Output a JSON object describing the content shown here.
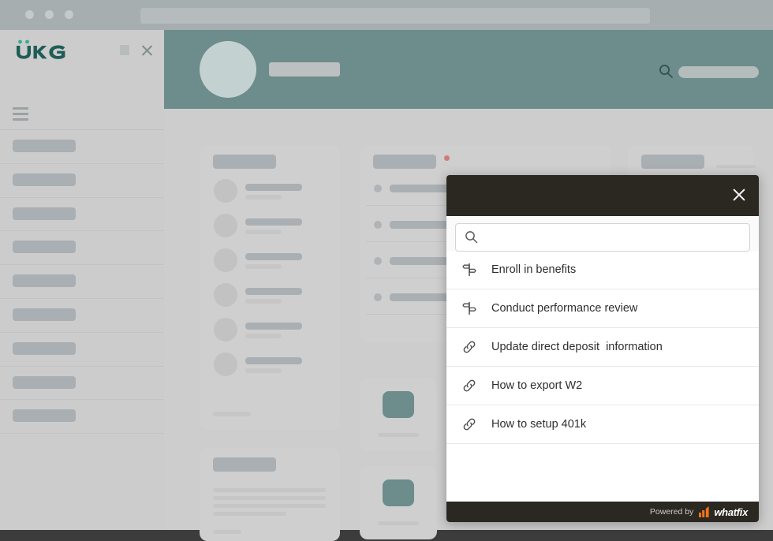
{
  "browser": {
    "traffic_lights": [
      "dot-1",
      "dot-2",
      "dot-3"
    ],
    "address_bar_value": ""
  },
  "app": {
    "brand": {
      "name": "UKG",
      "logo_color": "#1f5c57",
      "accent_color": "#3aa99a"
    },
    "window_controls": {
      "maximize_label": "",
      "close_label": ""
    },
    "menu_icon": "hamburger-menu-icon",
    "header": {
      "accent_color": "#6d8c8c",
      "avatar": "user-avatar-placeholder",
      "search_icon": "search-icon",
      "search_value": ""
    },
    "sidebar": {
      "items": [
        {
          "label": ""
        },
        {
          "label": ""
        },
        {
          "label": ""
        },
        {
          "label": ""
        },
        {
          "label": ""
        },
        {
          "label": ""
        },
        {
          "label": ""
        },
        {
          "label": ""
        },
        {
          "label": ""
        }
      ]
    },
    "content_placeholder_note": ""
  },
  "popup": {
    "title": "",
    "close_icon": "close-icon",
    "search": {
      "icon": "search-icon",
      "value": "",
      "placeholder": ""
    },
    "results": [
      {
        "icon": "signpost-icon",
        "label": "Enroll in benefits"
      },
      {
        "icon": "signpost-icon",
        "label": "Conduct performance review"
      },
      {
        "icon": "link-icon",
        "label": "Update direct deposit  information"
      },
      {
        "icon": "link-icon",
        "label": "How to export W2"
      },
      {
        "icon": "link-icon",
        "label": "How to setup 401k"
      }
    ],
    "footer": {
      "powered_by": "Powered by",
      "vendor": "whatfix",
      "vendor_mark_color": "#f2731c",
      "background_color": "#2b2721"
    }
  }
}
